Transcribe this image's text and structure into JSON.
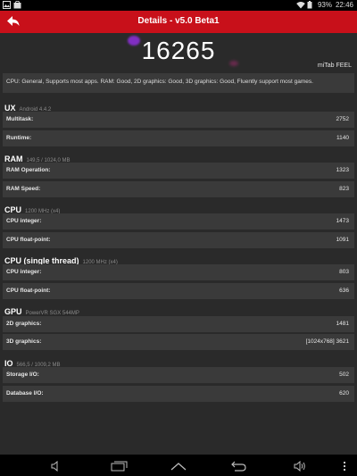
{
  "status": {
    "battery": "93%",
    "time": "22:46"
  },
  "actionbar": {
    "title": "Details - v5.0 Beta1"
  },
  "score": "16265",
  "device": "miTab FEEL",
  "summary": "CPU: General, Supports most apps. RAM: Good, 2D graphics: Good, 3D graphics: Good, Fluently support most games.",
  "sections": {
    "ux": {
      "name": "UX",
      "sub": "Android 4.4.2",
      "rows": [
        {
          "label": "Multitask:",
          "value": "2752"
        },
        {
          "label": "Runtime:",
          "value": "1140"
        }
      ]
    },
    "ram": {
      "name": "RAM",
      "sub": "149,5 / 1024,0 MB",
      "rows": [
        {
          "label": "RAM Operation:",
          "value": "1323"
        },
        {
          "label": "RAM Speed:",
          "value": "823"
        }
      ]
    },
    "cpu": {
      "name": "CPU",
      "sub": "1200 MHz (x4)",
      "rows": [
        {
          "label": "CPU integer:",
          "value": "1473"
        },
        {
          "label": "CPU float-point:",
          "value": "1091"
        }
      ]
    },
    "cpu_single": {
      "name": "CPU (single thread)",
      "sub": "1200 MHz (x4)",
      "rows": [
        {
          "label": "CPU integer:",
          "value": "803"
        },
        {
          "label": "CPU float-point:",
          "value": "636"
        }
      ]
    },
    "gpu": {
      "name": "GPU",
      "sub": "PowerVR SGX 544MP",
      "rows": [
        {
          "label": "2D graphics:",
          "value": "1481"
        },
        {
          "label": "3D graphics:",
          "value": "[1024x768] 3621"
        }
      ]
    },
    "io": {
      "name": "IO",
      "sub": "566,5 / 1009,2 MB",
      "rows": [
        {
          "label": "Storage I/O:",
          "value": "502"
        },
        {
          "label": "Database I/O:",
          "value": "620"
        }
      ]
    }
  },
  "colors": {
    "accent": "#c8101a",
    "background": "#2a2a2a",
    "row": "#3a3a3a"
  },
  "icons": [
    "image-icon",
    "store-icon",
    "wifi-icon",
    "battery-icon",
    "back-arrow-icon",
    "volume-down-icon",
    "recent-apps-icon",
    "home-icon",
    "back-icon",
    "volume-up-icon",
    "menu-icon"
  ]
}
